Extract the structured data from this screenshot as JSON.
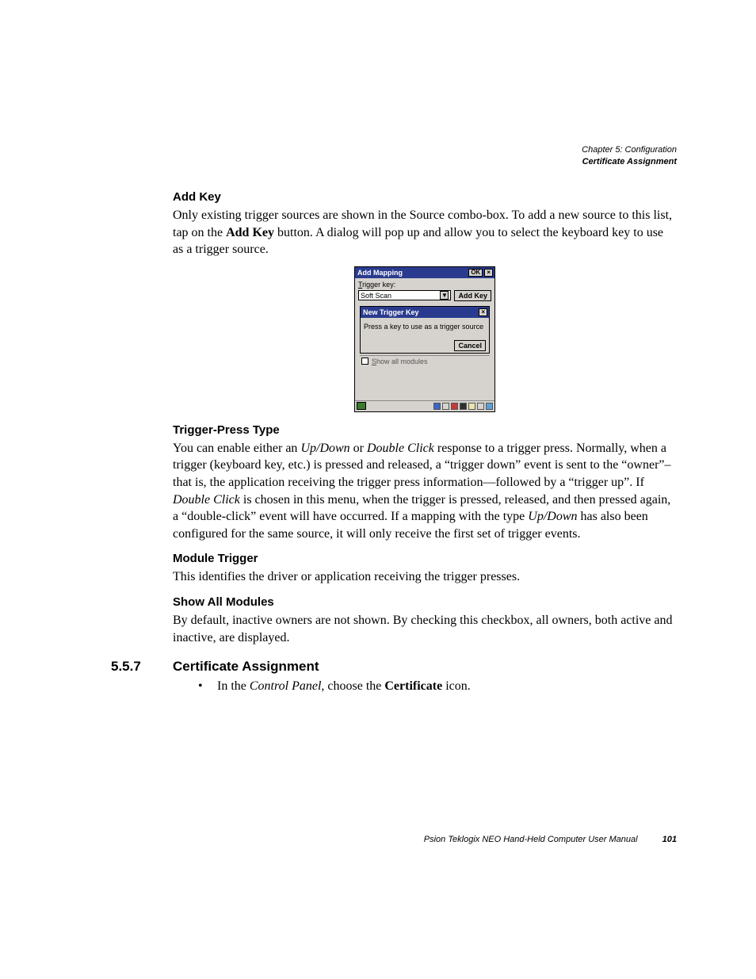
{
  "header": {
    "chapter": "Chapter 5: Configuration",
    "section": "Certificate Assignment"
  },
  "sections": {
    "addkey": {
      "heading": "Add Key",
      "p1a": "Only existing trigger sources are shown in the Source combo-box. To add a new source to this list, tap on the ",
      "p1b": "Add Key",
      "p1c": " button. A dialog will pop up and allow you to select the keyboard key to use as a trigger source."
    },
    "trigger": {
      "heading": "Trigger-Press Type",
      "p": {
        "t1": "You can enable either an ",
        "i1": "Up/Down",
        "t2": " or ",
        "i2": "Double Click",
        "t3": " response to a trigger press. Normally, when a trigger (keyboard key, etc.) is pressed and released, a “trigger down” event is sent to the “owner”– that is, the application receiving the trigger press information—followed by a “trigger up”. If ",
        "i3": "Double Click",
        "t4": " is chosen in this menu, when the trigger is pressed, released, and then pressed again, a “double-click” event will have occurred. If a mapping with the type ",
        "i4": "Up/Down",
        "t5": " has also been configured for the same source, it will only receive the first set of trigger events."
      }
    },
    "module": {
      "heading": "Module Trigger",
      "p": "This identifies the driver or application receiving the trigger presses."
    },
    "showall": {
      "heading": "Show All Modules",
      "p": "By default, inactive owners are not shown. By checking this checkbox, all owners, both active and inactive, are displayed."
    },
    "cert": {
      "number": "5.5.7",
      "heading": "Certificate Assignment",
      "bullet": {
        "t1": "In the ",
        "i1": "Control Panel",
        "t2": ", choose the ",
        "b1": "Certificate",
        "t3": " icon."
      }
    }
  },
  "shot": {
    "dlg1_title": "Add Mapping",
    "ok": "OK",
    "close": "×",
    "trigger_label_u": "T",
    "trigger_label_rest": "rigger key:",
    "combo_value": "Soft Scan",
    "addkey_btn": "Add Key",
    "dlg2_title": "New Trigger Key",
    "dlg2_msg": "Press a key to use as a trigger source",
    "cancel": "Cancel",
    "show_all_u": "S",
    "show_all_rest": "how all modules"
  },
  "footer": {
    "text": "Psion Teklogix NEO Hand-Held Computer User Manual",
    "page": "101"
  }
}
